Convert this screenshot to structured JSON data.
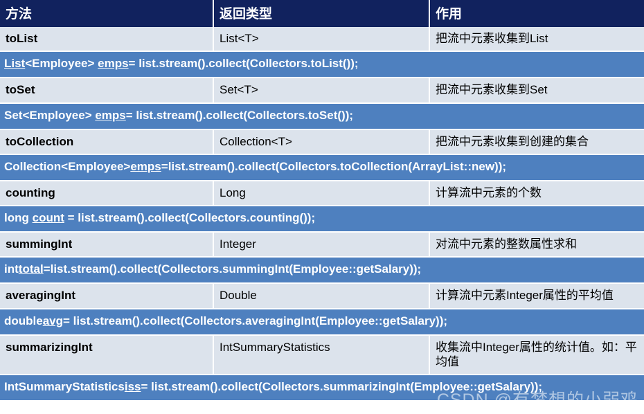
{
  "table": {
    "headers": [
      "方法",
      "返回类型",
      "作用"
    ],
    "rows": [
      {
        "method": "toList",
        "return_type": "List<T>",
        "usage": "把流中元素收集到List",
        "code": {
          "segments": [
            {
              "text": "List",
              "underline": true
            },
            {
              "text": "<Employee> ",
              "underline": false
            },
            {
              "text": "emps",
              "underline": true
            },
            {
              "text": "= list.stream().collect(Collectors.toList());",
              "underline": false
            }
          ],
          "plain": "List<Employee> emps= list.stream().collect(Collectors.toList());"
        }
      },
      {
        "method": "toSet",
        "return_type": "Set<T>",
        "usage": "把流中元素收集到Set",
        "code": {
          "segments": [
            {
              "text": "Set<Employee> ",
              "underline": false
            },
            {
              "text": "emps",
              "underline": true
            },
            {
              "text": "= list.stream().collect(Collectors.toSet());",
              "underline": false
            }
          ],
          "plain": "Set<Employee> emps= list.stream().collect(Collectors.toSet());"
        }
      },
      {
        "method": "toCollection",
        "return_type": "Collection<T>",
        "usage": "把流中元素收集到创建的集合",
        "code": {
          "segments": [
            {
              "text": "Collection<Employee>",
              "underline": false
            },
            {
              "text": "emps",
              "underline": true
            },
            {
              "text": "=list.stream().collect(Collectors.toCollection(ArrayList::new));",
              "underline": false
            }
          ],
          "plain": "Collection<Employee>emps=list.stream().collect(Collectors.toCollection(ArrayList::new));"
        }
      },
      {
        "method": "counting",
        "return_type": "Long",
        "usage": "计算流中元素的个数",
        "code": {
          "segments": [
            {
              "text": "long ",
              "underline": false
            },
            {
              "text": "count",
              "underline": true
            },
            {
              "text": " = list.stream().collect(Collectors.counting());",
              "underline": false
            }
          ],
          "plain": "long count = list.stream().collect(Collectors.counting());"
        }
      },
      {
        "method": "summingInt",
        "return_type": "Integer",
        "usage": "对流中元素的整数属性求和",
        "code": {
          "segments": [
            {
              "text": "int",
              "underline": false
            },
            {
              "text": "total",
              "underline": true
            },
            {
              "text": "=list.stream().collect(Collectors.summingInt(Employee::getSalary));",
              "underline": false
            }
          ],
          "plain": "inttotal=list.stream().collect(Collectors.summingInt(Employee::getSalary));"
        }
      },
      {
        "method": "averagingInt",
        "return_type": "Double",
        "usage": "计算流中元素Integer属性的平均值",
        "code": {
          "segments": [
            {
              "text": "double",
              "underline": false
            },
            {
              "text": "avg",
              "underline": true
            },
            {
              "text": "= list.stream().collect(Collectors.averagingInt(Employee::getSalary));",
              "underline": false
            }
          ],
          "plain": "doubleavg= list.stream().collect(Collectors.averagingInt(Employee::getSalary));"
        }
      },
      {
        "method": "summarizingInt",
        "return_type": "IntSummaryStatistics",
        "usage": "收集流中Integer属性的统计值。如：平均值",
        "code": {
          "segments": [
            {
              "text": "IntSummaryStatistics",
              "underline": false
            },
            {
              "text": "iss",
              "underline": true
            },
            {
              "text": "= list.stream().collect(Collectors.summarizingInt(Employee::getSalary));",
              "underline": false
            }
          ],
          "plain": "IntSummaryStatisticsiss= list.stream().collect(Collectors.summarizingInt(Employee::getSalary));"
        }
      }
    ]
  },
  "watermark": {
    "text": "CSDN @有梦想的小弱鸡"
  },
  "colors": {
    "header_bg": "#11225e",
    "row_bg": "#dce3ec",
    "code_bg": "#4e80bf",
    "grid": "#ffffff"
  }
}
